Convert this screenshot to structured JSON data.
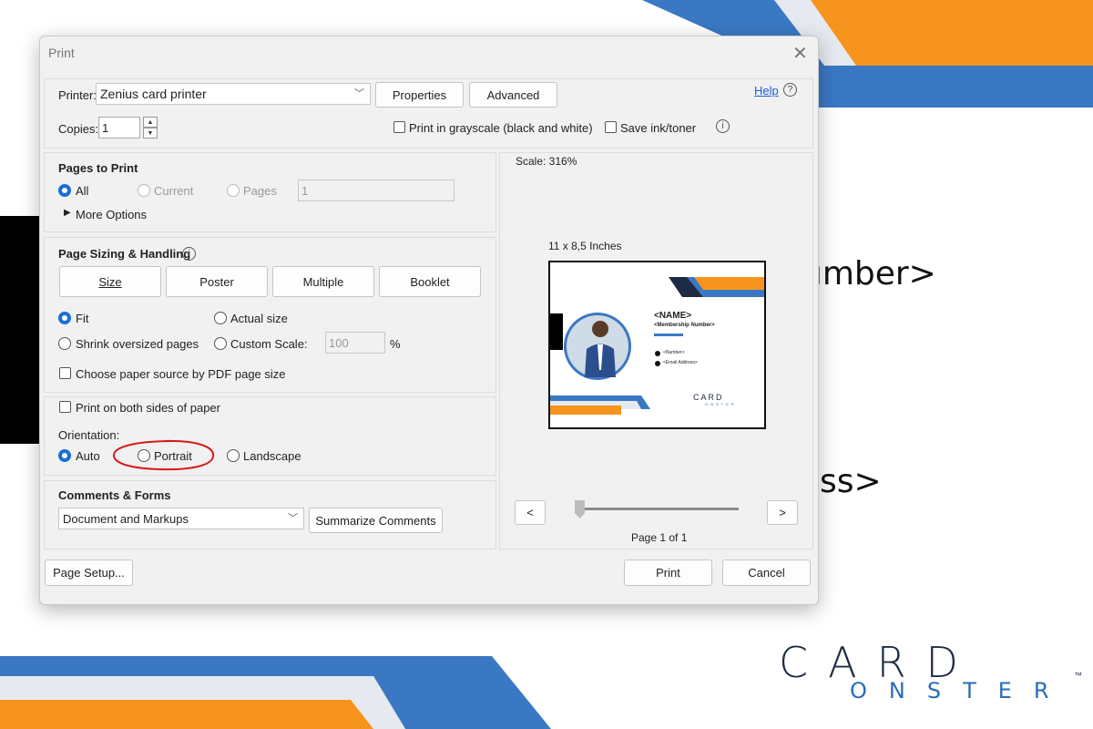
{
  "background": {
    "text_right_1": "umber>",
    "text_right_2": "ss>",
    "logo_top": "CARD",
    "logo_bottom": "ONSTER",
    "logo_tm": "™",
    "colors": {
      "orange": "#f7941d",
      "blue": "#3a78c3",
      "dark": "#1f2a44",
      "black": "#000000"
    }
  },
  "dialog": {
    "title": "Print",
    "close_icon": "close-icon",
    "printer": {
      "label": "Printer:",
      "value": "Zenius card printer",
      "properties": "Properties",
      "advanced": "Advanced",
      "help": "Help"
    },
    "copies": {
      "label": "Copies:",
      "value": "1"
    },
    "grayscale": "Print in grayscale (black and white)",
    "save_ink": "Save ink/toner",
    "pages_to_print": {
      "heading": "Pages to Print",
      "all": "All",
      "current": "Current",
      "pages": "Pages",
      "pages_value": "1",
      "more_options": "More Options"
    },
    "sizing": {
      "heading": "Page Sizing & Handling",
      "tabs": [
        "Size",
        "Poster",
        "Multiple",
        "Booklet"
      ],
      "fit": "Fit",
      "actual_size": "Actual size",
      "shrink": "Shrink oversized pages",
      "custom_scale": "Custom Scale:",
      "scale_value": "100",
      "percent": "%",
      "paper_source": "Choose paper source by PDF page size"
    },
    "both_sides": "Print on both sides of paper",
    "orientation": {
      "label": "Orientation:",
      "auto": "Auto",
      "portrait": "Portrait",
      "landscape": "Landscape"
    },
    "comments": {
      "heading": "Comments & Forms",
      "value": "Document and Markups",
      "summarize": "Summarize Comments"
    },
    "preview": {
      "scale": "Scale: 316%",
      "size": "11 x 8,5 Inches",
      "page": "Page 1 of 1",
      "prev": "<",
      "next": ">",
      "card": {
        "name": "<NAME>",
        "membership": "<Membership Number>",
        "number": "<Number>",
        "email": "<Email Address>",
        "logo": "CARD",
        "logo_sub": "ONSTER"
      }
    },
    "page_setup": "Page Setup...",
    "print": "Print",
    "cancel": "Cancel"
  }
}
